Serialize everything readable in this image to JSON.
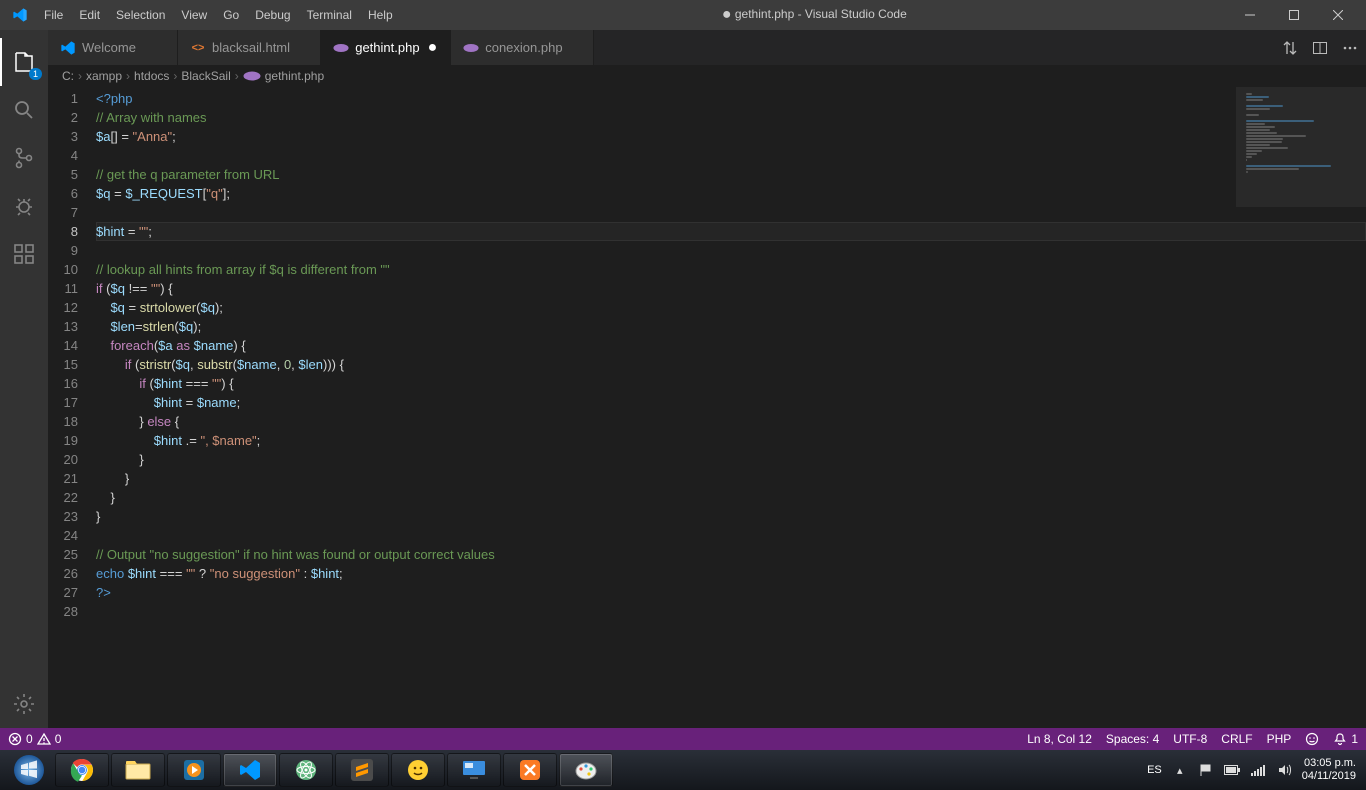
{
  "menus": [
    "File",
    "Edit",
    "Selection",
    "View",
    "Go",
    "Debug",
    "Terminal",
    "Help"
  ],
  "window_title_prefix": "●",
  "window_title": "gethint.php - Visual Studio Code",
  "tabs": [
    {
      "icon": "vs",
      "label": "Welcome",
      "dirty": false,
      "active": false,
      "color": "#519aba"
    },
    {
      "icon": "html",
      "label": "blacksail.html",
      "dirty": false,
      "active": false,
      "color": "#e37933"
    },
    {
      "icon": "php",
      "label": "gethint.php",
      "dirty": true,
      "active": true,
      "color": "#a074c4"
    },
    {
      "icon": "php",
      "label": "conexion.php",
      "dirty": false,
      "active": false,
      "color": "#a074c4"
    }
  ],
  "breadcrumbs": [
    "C:",
    "xampp",
    "htdocs",
    "BlackSail",
    "gethint.php"
  ],
  "breadcrumb_file_icon": "php",
  "activity_badge": "1",
  "current_line": 8,
  "status": {
    "errors": "0",
    "warnings": "0",
    "ln_col": "Ln 8, Col 12",
    "spaces": "Spaces: 4",
    "encoding": "UTF-8",
    "eol": "CRLF",
    "lang": "PHP",
    "notif": "1"
  },
  "tray": {
    "lang": "ES",
    "time": "03:05 p.m.",
    "date": "04/11/2019"
  },
  "code": [
    [
      [
        "delim",
        "<?"
      ],
      [
        "kw",
        "php"
      ]
    ],
    [
      [
        "com",
        "// Array with names"
      ]
    ],
    [
      [
        "var",
        "$a"
      ],
      [
        "pun",
        "[] "
      ],
      [
        "op",
        "="
      ],
      [
        "plain",
        " "
      ],
      [
        "str",
        "\"Anna\""
      ],
      [
        "pun",
        ";"
      ]
    ],
    [],
    [
      [
        "com",
        "// get the q parameter from URL"
      ]
    ],
    [
      [
        "var",
        "$q"
      ],
      [
        "plain",
        " "
      ],
      [
        "op",
        "="
      ],
      [
        "plain",
        " "
      ],
      [
        "var",
        "$_REQUEST"
      ],
      [
        "pun",
        "["
      ],
      [
        "str",
        "\"q\""
      ],
      [
        "pun",
        "];"
      ]
    ],
    [],
    [
      [
        "var",
        "$hint"
      ],
      [
        "plain",
        " "
      ],
      [
        "op",
        "="
      ],
      [
        "plain",
        " "
      ],
      [
        "str",
        "\"\""
      ],
      [
        "pun",
        ";"
      ]
    ],
    [],
    [
      [
        "com",
        "// lookup all hints from array if $q is different from \"\""
      ]
    ],
    [
      [
        "ctrl",
        "if"
      ],
      [
        "plain",
        " "
      ],
      [
        "pun",
        "("
      ],
      [
        "var",
        "$q"
      ],
      [
        "plain",
        " "
      ],
      [
        "op",
        "!=="
      ],
      [
        "plain",
        " "
      ],
      [
        "str",
        "\"\""
      ],
      [
        "pun",
        ")"
      ],
      [
        "plain",
        " "
      ],
      [
        "pun",
        "{"
      ]
    ],
    [
      [
        "plain",
        "    "
      ],
      [
        "var",
        "$q"
      ],
      [
        "plain",
        " "
      ],
      [
        "op",
        "="
      ],
      [
        "plain",
        " "
      ],
      [
        "fn",
        "strtolower"
      ],
      [
        "pun",
        "("
      ],
      [
        "var",
        "$q"
      ],
      [
        "pun",
        ");"
      ]
    ],
    [
      [
        "plain",
        "    "
      ],
      [
        "var",
        "$len"
      ],
      [
        "op",
        "="
      ],
      [
        "fn",
        "strlen"
      ],
      [
        "pun",
        "("
      ],
      [
        "var",
        "$q"
      ],
      [
        "pun",
        ");"
      ]
    ],
    [
      [
        "plain",
        "    "
      ],
      [
        "ctrl",
        "foreach"
      ],
      [
        "pun",
        "("
      ],
      [
        "var",
        "$a"
      ],
      [
        "plain",
        " "
      ],
      [
        "ctrl",
        "as"
      ],
      [
        "plain",
        " "
      ],
      [
        "var",
        "$name"
      ],
      [
        "pun",
        ")"
      ],
      [
        "plain",
        " "
      ],
      [
        "pun",
        "{"
      ]
    ],
    [
      [
        "plain",
        "        "
      ],
      [
        "ctrl",
        "if"
      ],
      [
        "plain",
        " "
      ],
      [
        "pun",
        "("
      ],
      [
        "fn",
        "stristr"
      ],
      [
        "pun",
        "("
      ],
      [
        "var",
        "$q"
      ],
      [
        "pun",
        ", "
      ],
      [
        "fn",
        "substr"
      ],
      [
        "pun",
        "("
      ],
      [
        "var",
        "$name"
      ],
      [
        "pun",
        ", "
      ],
      [
        "num",
        "0"
      ],
      [
        "pun",
        ", "
      ],
      [
        "var",
        "$len"
      ],
      [
        "pun",
        ")))"
      ],
      [
        "plain",
        " "
      ],
      [
        "pun",
        "{"
      ]
    ],
    [
      [
        "plain",
        "            "
      ],
      [
        "ctrl",
        "if"
      ],
      [
        "plain",
        " "
      ],
      [
        "pun",
        "("
      ],
      [
        "var",
        "$hint"
      ],
      [
        "plain",
        " "
      ],
      [
        "op",
        "==="
      ],
      [
        "plain",
        " "
      ],
      [
        "str",
        "\"\""
      ],
      [
        "pun",
        ")"
      ],
      [
        "plain",
        " "
      ],
      [
        "pun",
        "{"
      ]
    ],
    [
      [
        "plain",
        "                "
      ],
      [
        "var",
        "$hint"
      ],
      [
        "plain",
        " "
      ],
      [
        "op",
        "="
      ],
      [
        "plain",
        " "
      ],
      [
        "var",
        "$name"
      ],
      [
        "pun",
        ";"
      ]
    ],
    [
      [
        "plain",
        "            "
      ],
      [
        "pun",
        "}"
      ],
      [
        "plain",
        " "
      ],
      [
        "ctrl",
        "else"
      ],
      [
        "plain",
        " "
      ],
      [
        "pun",
        "{"
      ]
    ],
    [
      [
        "plain",
        "                "
      ],
      [
        "var",
        "$hint"
      ],
      [
        "plain",
        " "
      ],
      [
        "op",
        ".="
      ],
      [
        "plain",
        " "
      ],
      [
        "str",
        "\", $name\""
      ],
      [
        "pun",
        ";"
      ]
    ],
    [
      [
        "plain",
        "            "
      ],
      [
        "pun",
        "}"
      ]
    ],
    [
      [
        "plain",
        "        "
      ],
      [
        "pun",
        "}"
      ]
    ],
    [
      [
        "plain",
        "    "
      ],
      [
        "pun",
        "}"
      ]
    ],
    [
      [
        "pun",
        "}"
      ]
    ],
    [],
    [
      [
        "com",
        "// Output \"no suggestion\" if no hint was found or output correct values"
      ]
    ],
    [
      [
        "kw",
        "echo"
      ],
      [
        "plain",
        " "
      ],
      [
        "var",
        "$hint"
      ],
      [
        "plain",
        " "
      ],
      [
        "op",
        "==="
      ],
      [
        "plain",
        " "
      ],
      [
        "str",
        "\"\""
      ],
      [
        "plain",
        " "
      ],
      [
        "op",
        "?"
      ],
      [
        "plain",
        " "
      ],
      [
        "str",
        "\"no suggestion\""
      ],
      [
        "plain",
        " "
      ],
      [
        "op",
        ":"
      ],
      [
        "plain",
        " "
      ],
      [
        "var",
        "$hint"
      ],
      [
        "pun",
        ";"
      ]
    ],
    [
      [
        "delim",
        "?>"
      ]
    ],
    []
  ]
}
